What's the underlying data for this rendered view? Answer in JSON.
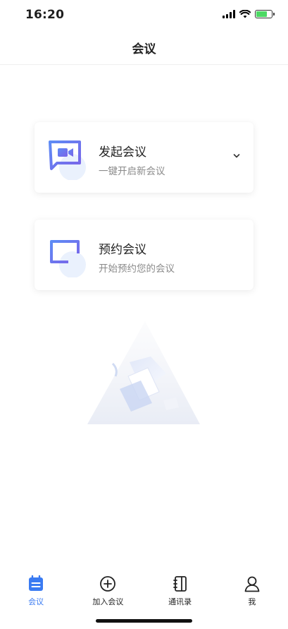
{
  "status_bar": {
    "time": "16:20"
  },
  "header": {
    "title": "会议"
  },
  "cards": [
    {
      "title": "发起会议",
      "subtitle": "一键开启新会议",
      "icon": "video-chat-icon"
    },
    {
      "title": "预约会议",
      "subtitle": "开始预约您的会议",
      "icon": "calendar-add-icon"
    }
  ],
  "tabs": [
    {
      "label": "会议",
      "icon": "calendar-list-icon",
      "active": true
    },
    {
      "label": "加入会议",
      "icon": "add-circle-icon",
      "active": false
    },
    {
      "label": "通讯录",
      "icon": "contacts-book-icon",
      "active": false
    },
    {
      "label": "我",
      "icon": "person-icon",
      "active": false
    }
  ],
  "colors": {
    "accent": "#3a7bf2",
    "icon_gradient_start": "#5d8bf5",
    "icon_gradient_end": "#7b63e8"
  }
}
